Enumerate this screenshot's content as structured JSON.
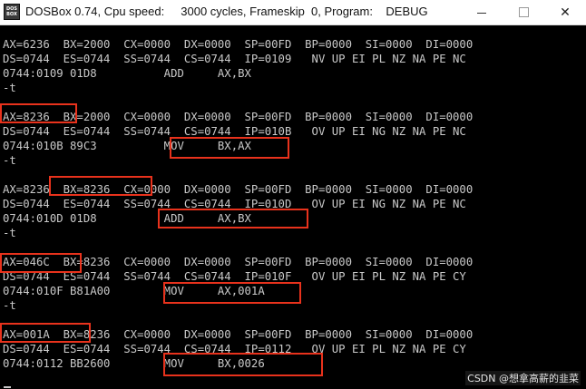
{
  "window": {
    "icon_text_1": "DOS",
    "icon_text_2": "BOX",
    "title": "DOSBox 0.74, Cpu speed:     3000 cycles, Frameskip  0, Program:    DEBUG",
    "minimize_glyph": "—",
    "close_glyph": "✕"
  },
  "console": {
    "lines": [
      "AX=6236  BX=2000  CX=0000  DX=0000  SP=00FD  BP=0000  SI=0000  DI=0000",
      "DS=0744  ES=0744  SS=0744  CS=0744  IP=0109   NV UP EI PL NZ NA PE NC",
      "0744:0109 01D8          ADD     AX,BX",
      "-t",
      "",
      "AX=8236  BX=2000  CX=0000  DX=0000  SP=00FD  BP=0000  SI=0000  DI=0000",
      "DS=0744  ES=0744  SS=0744  CS=0744  IP=010B   OV UP EI NG NZ NA PE NC",
      "0744:010B 89C3          MOV     BX,AX",
      "-t",
      "",
      "AX=8236  BX=8236  CX=0000  DX=0000  SP=00FD  BP=0000  SI=0000  DI=0000",
      "DS=0744  ES=0744  SS=0744  CS=0744  IP=010D   OV UP EI NG NZ NA PE NC",
      "0744:010D 01D8          ADD     AX,BX",
      "-t",
      "",
      "AX=046C  BX=8236  CX=0000  DX=0000  SP=00FD  BP=0000  SI=0000  DI=0000",
      "DS=0744  ES=0744  SS=0744  CS=0744  IP=010F   OV UP EI PL NZ NA PE CY",
      "0744:010F B81A00        MOV     AX,001A",
      "-t",
      "",
      "AX=001A  BX=8236  CX=0000  DX=0000  SP=00FD  BP=0000  SI=0000  DI=0000",
      "DS=0744  ES=0744  SS=0744  CS=0744  IP=0112   OV UP EI PL NZ NA PE CY",
      "0744:0112 BB2600        MOV     BX,0026"
    ]
  },
  "watermark": "CSDN @想拿高薪的韭菜",
  "colors": {
    "console_bg": "#000000",
    "console_text": "#c9c9c9",
    "highlight": "#e8321c"
  }
}
